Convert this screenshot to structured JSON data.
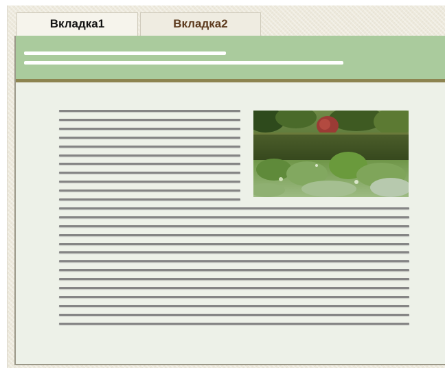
{
  "tabs": [
    {
      "label": "Вкладка1",
      "active": true
    },
    {
      "label": "Вкладка2",
      "active": false
    }
  ],
  "panel": {
    "header": {
      "lines": [
        {
          "type": "placeholder-text-line"
        },
        {
          "type": "placeholder-text-line"
        }
      ]
    },
    "content": {
      "image": {
        "subject": "garden-photo"
      },
      "text_lines_beside_image": 11,
      "text_lines_full_width": 14
    }
  },
  "colors": {
    "window_background": "#ede9dc",
    "panel_background": "#edf1e8",
    "header_background": "#aacb9d",
    "header_divider": "#8d8450",
    "active_tab_text": "#111111",
    "inactive_tab_text": "#5d3b1e",
    "placeholder_line": "#858585"
  }
}
